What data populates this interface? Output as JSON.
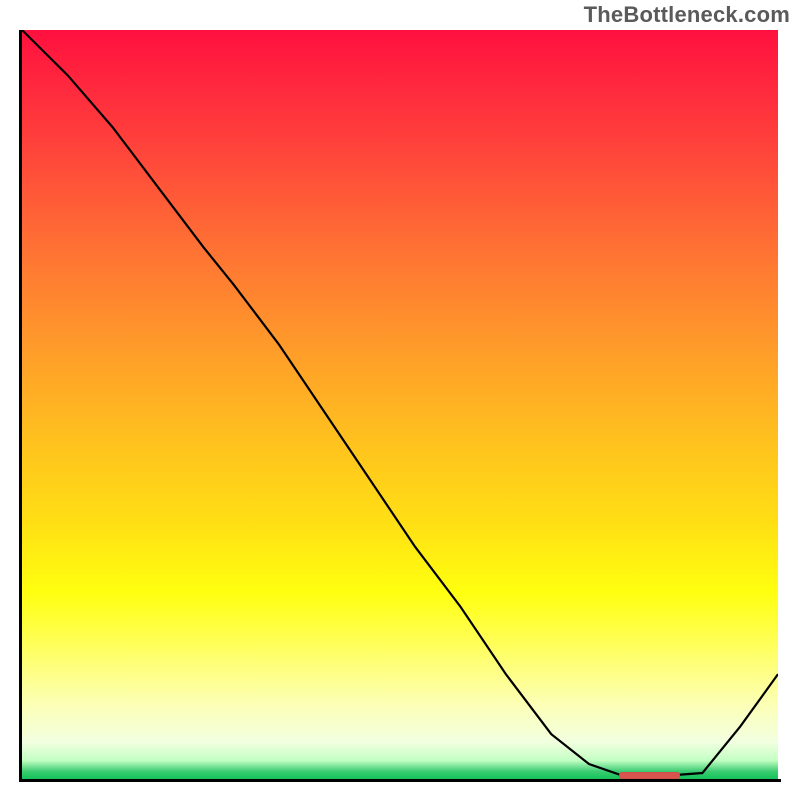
{
  "watermark": "TheBottleneck.com",
  "colors": {
    "curve": "#000000",
    "axis": "#000000",
    "marker": "#d9534f",
    "gradient_top": "#ff103f",
    "gradient_bottom": "#14c35b"
  },
  "chart_data": {
    "type": "line",
    "title": "",
    "xlabel": "",
    "ylabel": "",
    "xlim": [
      0,
      100
    ],
    "ylim": [
      0,
      100
    ],
    "grid": false,
    "legend": false,
    "series": [
      {
        "name": "bottleneck-curve",
        "x": [
          0,
          6,
          12,
          18,
          24,
          28,
          34,
          40,
          46,
          52,
          58,
          64,
          70,
          75,
          79,
          83,
          86,
          90,
          95,
          100
        ],
        "y": [
          100,
          94,
          87,
          79,
          71,
          66,
          58,
          49,
          40,
          31,
          23,
          14,
          6,
          2,
          0.6,
          0.4,
          0.5,
          0.8,
          7,
          14
        ]
      }
    ],
    "annotations": [
      {
        "name": "optimal-region-marker",
        "x_start": 79,
        "x_end": 87,
        "y": 0.5
      }
    ]
  }
}
